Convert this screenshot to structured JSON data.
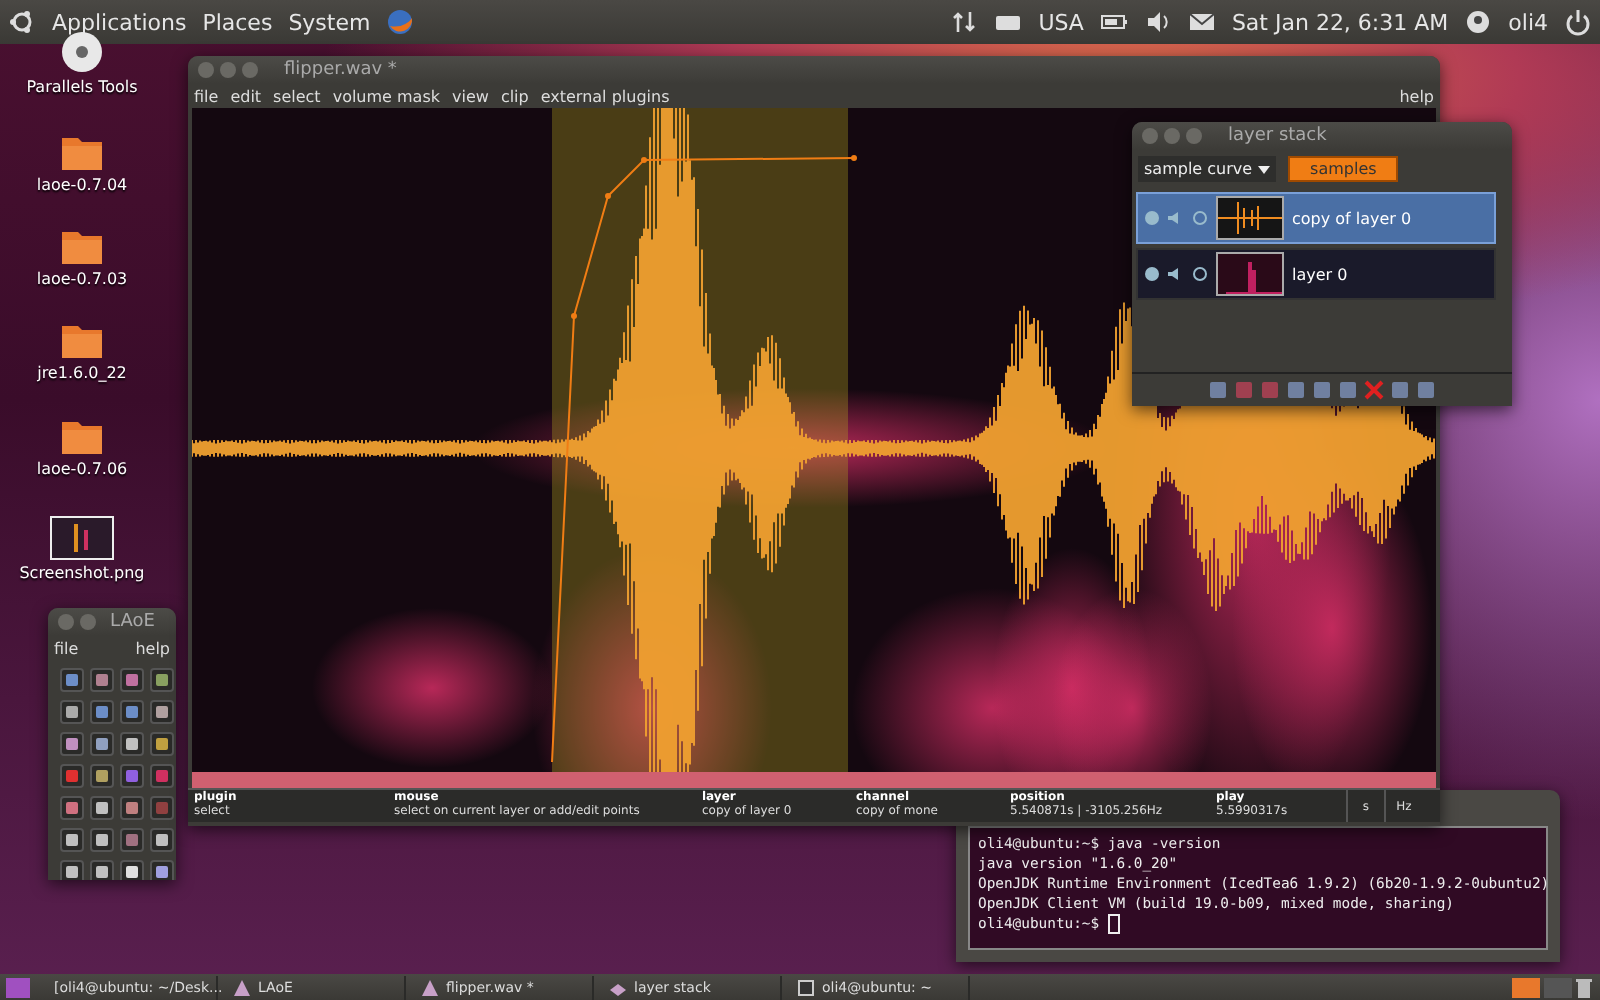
{
  "top_panel": {
    "menus": [
      "Applications",
      "Places",
      "System"
    ],
    "keyboard": "USA",
    "clock": "Sat Jan 22, 6:31 AM",
    "user": "oli4"
  },
  "desktop_icons": [
    {
      "label": "Parallels Tools",
      "kind": "disc"
    },
    {
      "label": "laoe-0.7.04",
      "kind": "folder"
    },
    {
      "label": "laoe-0.7.03",
      "kind": "folder"
    },
    {
      "label": "jre1.6.0_22",
      "kind": "folder"
    },
    {
      "label": "laoe-0.7.06",
      "kind": "folder"
    },
    {
      "label": "Screenshot.png",
      "kind": "image"
    }
  ],
  "laoe_window": {
    "title": "LAoE",
    "menu": [
      "file",
      "help"
    ]
  },
  "flipper_window": {
    "title": "flipper.wav *",
    "menu": [
      "file",
      "edit",
      "select",
      "volume mask",
      "view",
      "clip",
      "external plugins"
    ],
    "help": "help",
    "status": [
      {
        "label": "plugin",
        "value": "select"
      },
      {
        "label": "mouse",
        "value": "select on current layer or add/edit points"
      },
      {
        "label": "layer",
        "value": "copy of layer 0"
      },
      {
        "label": "channel",
        "value": "copy of mone"
      },
      {
        "label": "position",
        "value": "5.540871s | -3105.256Hz"
      },
      {
        "label": "play",
        "value": "5.5990317s"
      }
    ],
    "units": [
      "s",
      "Hz"
    ]
  },
  "layer_stack": {
    "title": "layer stack",
    "dropdown": "sample curve",
    "mode_button": {
      "label": "samples",
      "selected": true
    },
    "layers": [
      {
        "name": "copy of layer 0",
        "selected": true,
        "kind": "waveform"
      },
      {
        "name": "layer 0",
        "selected": false,
        "kind": "spectrum"
      }
    ]
  },
  "terminal": {
    "lines": [
      "oli4@ubuntu:~$ java -version",
      "java version \"1.6.0_20\"",
      "OpenJDK Runtime Environment (IcedTea6 1.9.2) (6b20-1.9.2-0ubuntu2)",
      "OpenJDK Client VM (build 19.0-b09, mixed mode, sharing)",
      "oli4@ubuntu:~$ "
    ]
  },
  "taskbar": {
    "tasks": [
      {
        "label": "[oli4@ubuntu: ~/Desk...",
        "kind": "terminal"
      },
      {
        "label": "LAoE",
        "kind": "app"
      },
      {
        "label": "flipper.wav *",
        "kind": "app"
      },
      {
        "label": "layer stack",
        "kind": "stack"
      },
      {
        "label": "oli4@ubuntu: ~",
        "kind": "terminal"
      }
    ]
  }
}
